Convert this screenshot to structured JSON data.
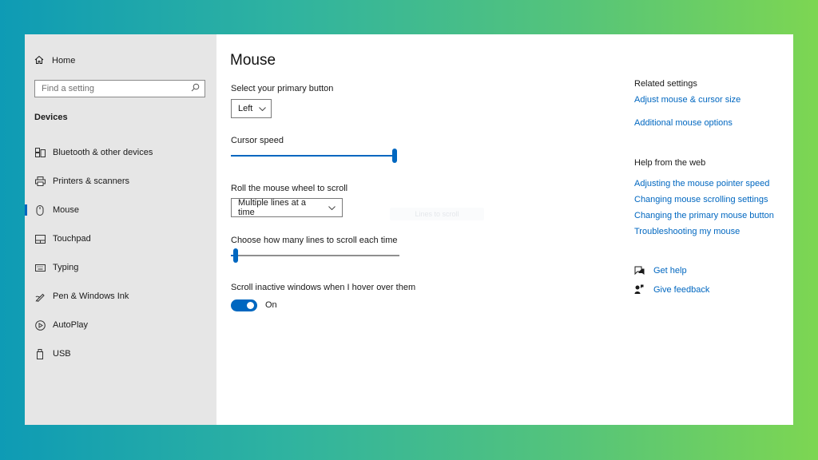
{
  "sidebar": {
    "home_label": "Home",
    "search_placeholder": "Find a setting",
    "section_title": "Devices",
    "items": [
      {
        "label": "Bluetooth & other devices",
        "icon": "bluetooth-devices-icon"
      },
      {
        "label": "Printers & scanners",
        "icon": "printer-icon"
      },
      {
        "label": "Mouse",
        "icon": "mouse-icon",
        "active": true
      },
      {
        "label": "Touchpad",
        "icon": "touchpad-icon"
      },
      {
        "label": "Typing",
        "icon": "keyboard-icon"
      },
      {
        "label": "Pen & Windows Ink",
        "icon": "pen-icon"
      },
      {
        "label": "AutoPlay",
        "icon": "autoplay-icon"
      },
      {
        "label": "USB",
        "icon": "usb-icon"
      }
    ]
  },
  "main": {
    "title": "Mouse",
    "primary_button": {
      "label": "Select your primary button",
      "value": "Left"
    },
    "cursor_speed": {
      "label": "Cursor speed",
      "level": 1.0
    },
    "scroll_mode": {
      "label": "Roll the mouse wheel to scroll",
      "value": "Multiple lines at a time"
    },
    "ghost_tooltip": "Lines to scroll",
    "lines_to_scroll": {
      "label": "Choose how many lines to scroll each time",
      "level": 0.03
    },
    "inactive_scroll": {
      "label": "Scroll inactive windows when I hover over them",
      "state": "On"
    }
  },
  "related": {
    "heading": "Related settings",
    "links": [
      "Adjust mouse & cursor size",
      "Additional mouse options"
    ]
  },
  "help": {
    "heading": "Help from the web",
    "links": [
      "Adjusting the mouse pointer speed",
      "Changing mouse scrolling settings",
      "Changing the primary mouse button",
      "Troubleshooting my mouse"
    ]
  },
  "actions": {
    "get_help": "Get help",
    "give_feedback": "Give feedback"
  },
  "colors": {
    "accent": "#0067c0",
    "sidebar_bg": "#e6e6e6",
    "gradient_start": "#0e9bb5",
    "gradient_end": "#7dd652"
  }
}
